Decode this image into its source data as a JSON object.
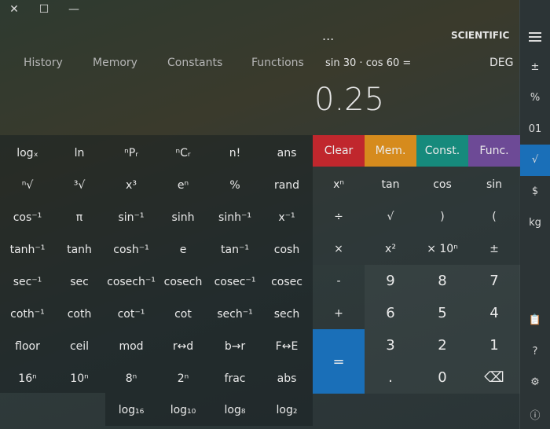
{
  "window": {
    "close": "✕",
    "maximize": "☐",
    "minimize": "—"
  },
  "title": "SCIENTIFIC",
  "more_menu": "...",
  "angle_mode": "DEG",
  "expression": "sin 30 · cos 60 =",
  "display_value": "0.25",
  "tabs": [
    "Functions",
    "Constants",
    "Memory",
    "History"
  ],
  "sidebar": {
    "items": [
      "±",
      "%",
      "01",
      "√",
      "$",
      "kg",
      "📋",
      "?",
      "⚙",
      "ⓘ"
    ]
  },
  "colors": {
    "func": "#6d4a96",
    "const": "#168a7c",
    "mem": "#d68b1d",
    "clear": "#c0272d",
    "equals": "#1a6fb8",
    "selected": "#1a6fb8"
  },
  "category_keys": [
    "Func.",
    "Const.",
    "Mem.",
    "Clear"
  ],
  "left_keys": [
    [
      "ans",
      "n!",
      "ⁿCᵣ",
      "ⁿPᵣ",
      "ln",
      "logₓ"
    ],
    [
      "rand",
      "%",
      "eⁿ",
      "x³",
      "³√",
      "ⁿ√"
    ],
    [
      "x⁻¹",
      "sinh⁻¹",
      "sinh",
      "sin⁻¹",
      "π",
      "cos⁻¹"
    ],
    [
      "cosh",
      "tan⁻¹",
      "e",
      "cosh⁻¹",
      "tanh",
      "tanh⁻¹"
    ],
    [
      "cosec",
      "cosec⁻¹",
      "cosech",
      "cosech⁻¹",
      "sec",
      "sec⁻¹"
    ],
    [
      "sech",
      "sech⁻¹",
      "cot",
      "cot⁻¹",
      "coth",
      "coth⁻¹"
    ],
    [
      "F↔E",
      "b→r",
      "r↔d",
      "mod",
      "ceil",
      "floor"
    ],
    [
      "abs",
      "frac",
      "2ⁿ",
      "8ⁿ",
      "10ⁿ",
      "16ⁿ"
    ]
  ],
  "bottom_keys": [
    "log₂",
    "log₈",
    "log₁₀",
    "log₁₆"
  ],
  "op_col1": [
    "xⁿ",
    "√",
    "x²",
    "-",
    "+"
  ],
  "op_col2": [
    "tan",
    ")",
    "× 10ⁿ",
    "9",
    "6",
    "3",
    "."
  ],
  "op_col3": [
    "cos",
    "(",
    "±",
    "8",
    "5",
    "2",
    "0"
  ],
  "op_col4": [
    "sin",
    "(",
    "±",
    "7",
    "4",
    "1",
    "⌫"
  ],
  "row2_c2": "÷",
  "row4_c2": "×",
  "equals": "="
}
